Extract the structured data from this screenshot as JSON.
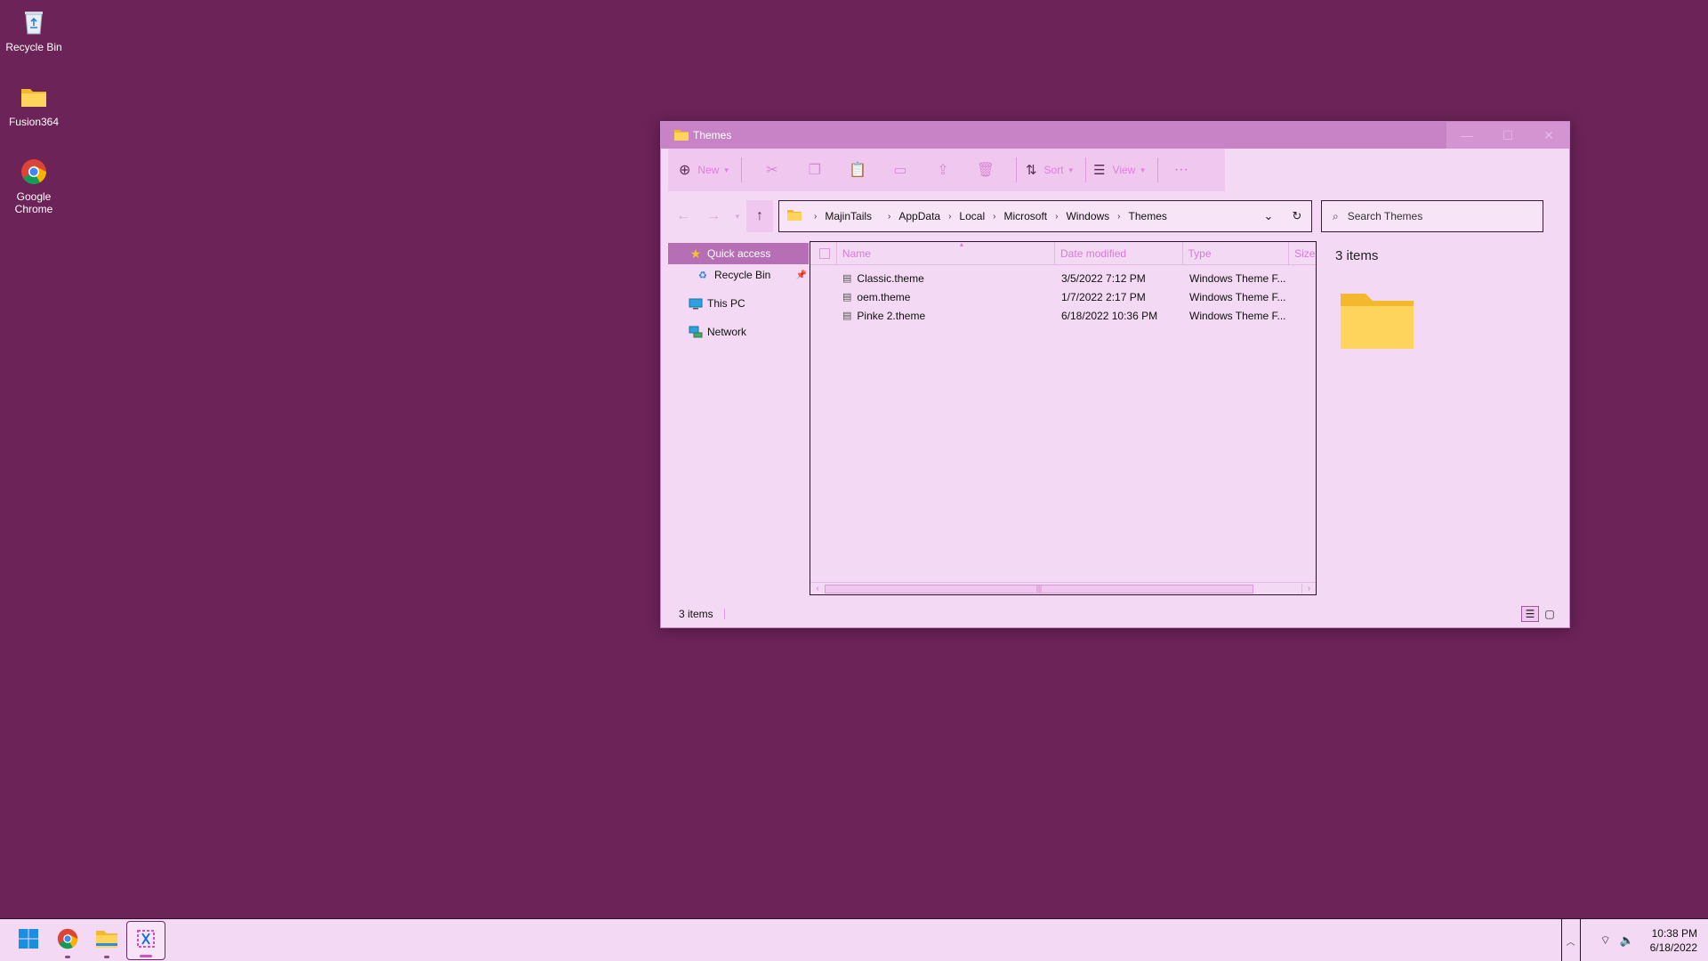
{
  "desktop": {
    "icons": [
      {
        "label": "Recycle Bin",
        "icon": "recycle-bin-icon"
      },
      {
        "label": "Fusion364",
        "icon": "folder-icon"
      },
      {
        "label": "Google Chrome",
        "icon": "chrome-icon"
      }
    ]
  },
  "window": {
    "title": "Themes",
    "controls": {
      "minimize": "—",
      "maximize": "☐",
      "close": "✕"
    },
    "toolbar": {
      "new_label": "New",
      "sort_label": "Sort",
      "view_label": "View",
      "more_label": "···"
    },
    "address": {
      "crumbs": [
        "MajinTails",
        "AppData",
        "Local",
        "Microsoft",
        "Windows",
        "Themes"
      ],
      "search_placeholder": "Search Themes"
    },
    "nav": {
      "quick_access": "Quick access",
      "recycle_bin": "Recycle Bin",
      "this_pc": "This PC",
      "network": "Network"
    },
    "columns": {
      "name": "Name",
      "date": "Date modified",
      "type": "Type",
      "size": "Size"
    },
    "files": [
      {
        "name": "Classic.theme",
        "date": "3/5/2022 7:12 PM",
        "type": "Windows Theme F..."
      },
      {
        "name": "oem.theme",
        "date": "1/7/2022 2:17 PM",
        "type": "Windows Theme F..."
      },
      {
        "name": "Pinke 2.theme",
        "date": "6/18/2022 10:36 PM",
        "type": "Windows Theme F..."
      }
    ],
    "preview_count": "3 items",
    "status": "3 items"
  },
  "taskbar": {
    "time": "10:38 PM",
    "date": "6/18/2022"
  },
  "colors": {
    "desktop": "#6c2358",
    "accent": "#b66fb4",
    "window_bg": "#f3d9f3"
  }
}
